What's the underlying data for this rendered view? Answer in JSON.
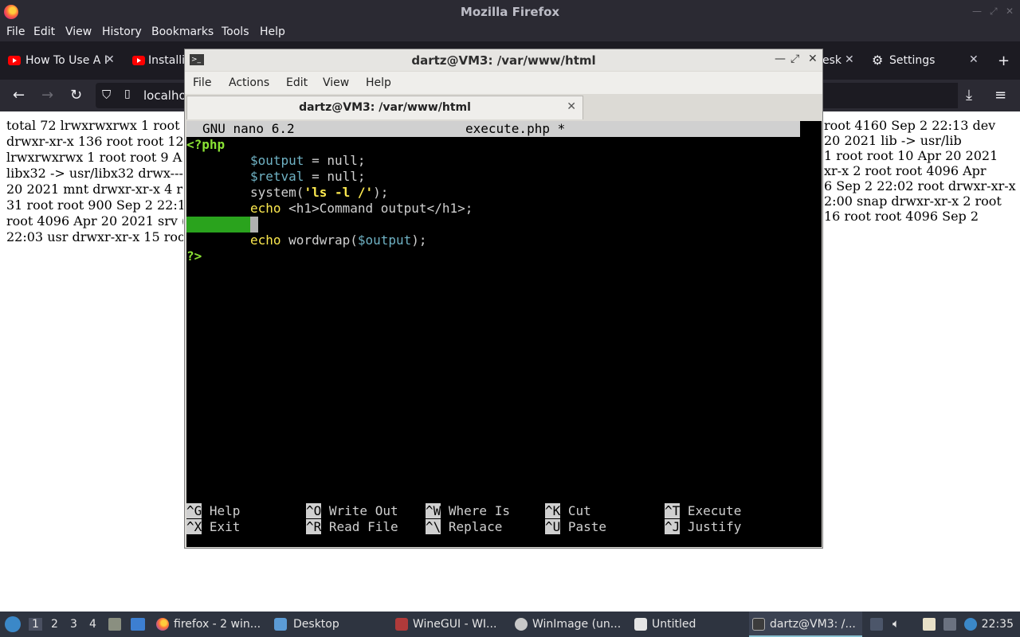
{
  "firefox": {
    "title": "Mozilla Firefox",
    "menu": [
      "File",
      "Edit",
      "View",
      "History",
      "Bookmarks",
      "Tools",
      "Help"
    ],
    "tabs": [
      {
        "label": "How To Use A I"
      },
      {
        "label": "Installi"
      },
      {
        "label": "esk"
      },
      {
        "label": "Settings"
      }
    ],
    "new_tab": "+",
    "url": "localho",
    "page_left": [
      "total 72 lrwxrwxrwx 1 root",
      "drwxr-xr-x 136 root root 12",
      "lrwxrwxrwx 1 root root 9 A",
      "libx32 -> usr/libx32 drwx---",
      "20 2021 mnt drwxr-xr-x 4 r",
      "31 root root 900 Sep 2 22:1",
      "root 4096 Apr 20 2021 srv (",
      "22:03 usr drwxr-xr-x 15 roo"
    ],
    "page_right": [
      "root 4160 Sep 2 22:13 dev",
      "20 2021 lib -> usr/lib",
      "1 root root 10 Apr 20 2021",
      "xr-x 2 root root 4096 Apr",
      "6 Sep 2 22:02 root drwxr-xr-x",
      "2:00 snap drwxr-xr-x 2 root",
      "16 root root 4096 Sep 2"
    ]
  },
  "terminal": {
    "title": "dartz@VM3: /var/www/html",
    "menu": [
      "File",
      "Actions",
      "Edit",
      "View",
      "Help"
    ],
    "tab_label": "dartz@VM3: /var/www/html",
    "nano": {
      "version": "GNU nano 6.2",
      "filename": "execute.php *",
      "lines": {
        "open_tag": "<?php",
        "l1_var": "$output",
        "l1_rest": " = null;",
        "l2_var": "$retval",
        "l2_rest": " = null;",
        "l3_fn": "system(",
        "l3_str": "'ls -l /'",
        "l3_end": ");",
        "l4_kw": "echo",
        "l4_rest": " <h1>Command output</h1>;",
        "l6_kw": "echo",
        "l6_fn": " wordwrap(",
        "l6_var": "$output",
        "l6_end": ");",
        "close_tag": "?>"
      },
      "shortcuts": [
        {
          "key": "^G",
          "label": " Help"
        },
        {
          "key": "^O",
          "label": " Write Out"
        },
        {
          "key": "^W",
          "label": " Where Is"
        },
        {
          "key": "^K",
          "label": " Cut"
        },
        {
          "key": "^T",
          "label": " Execute"
        },
        {
          "key": "^X",
          "label": " Exit"
        },
        {
          "key": "^R",
          "label": " Read File"
        },
        {
          "key": "^\\",
          "label": " Replace"
        },
        {
          "key": "^U",
          "label": " Paste"
        },
        {
          "key": "^J",
          "label": " Justify"
        }
      ]
    }
  },
  "taskbar": {
    "workspaces": [
      "1",
      "2",
      "3",
      "4"
    ],
    "tasks": [
      {
        "label": "firefox - 2 win..."
      },
      {
        "label": "Desktop"
      },
      {
        "label": "WineGUI - WI..."
      },
      {
        "label": "WinImage (un..."
      },
      {
        "label": "Untitled"
      },
      {
        "label": "dartz@VM3: /..."
      }
    ],
    "clock": "22:35"
  }
}
